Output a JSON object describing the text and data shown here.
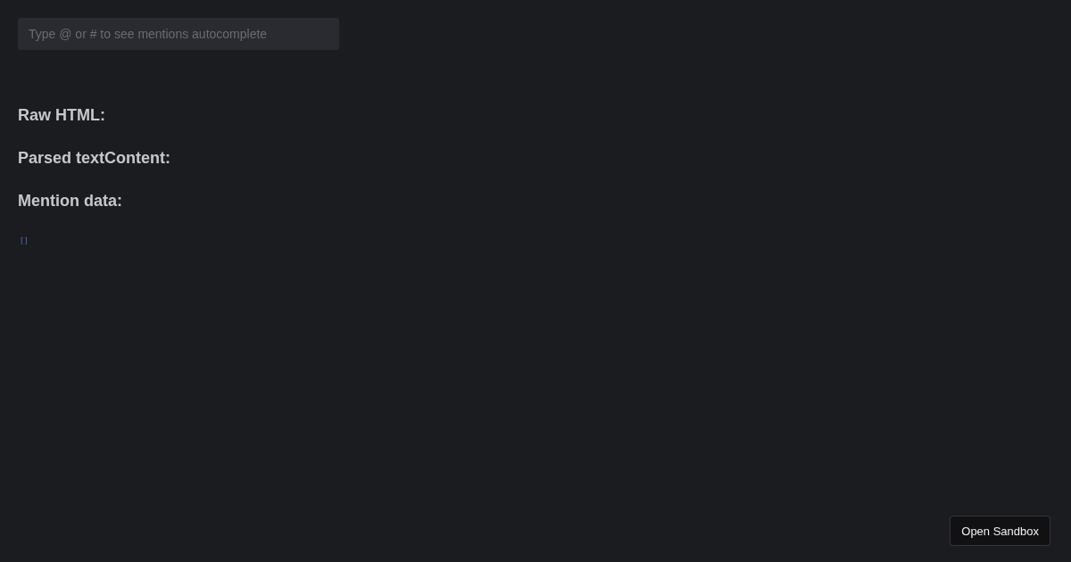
{
  "editor": {
    "placeholder": "Type @ or # to see mentions autocomplete"
  },
  "sections": [
    {
      "heading": "Raw HTML:"
    },
    {
      "heading": "Parsed textContent:"
    },
    {
      "heading": "Mention data:"
    }
  ],
  "mention_data": "[]",
  "open_sandbox_button": "Open Sandbox"
}
